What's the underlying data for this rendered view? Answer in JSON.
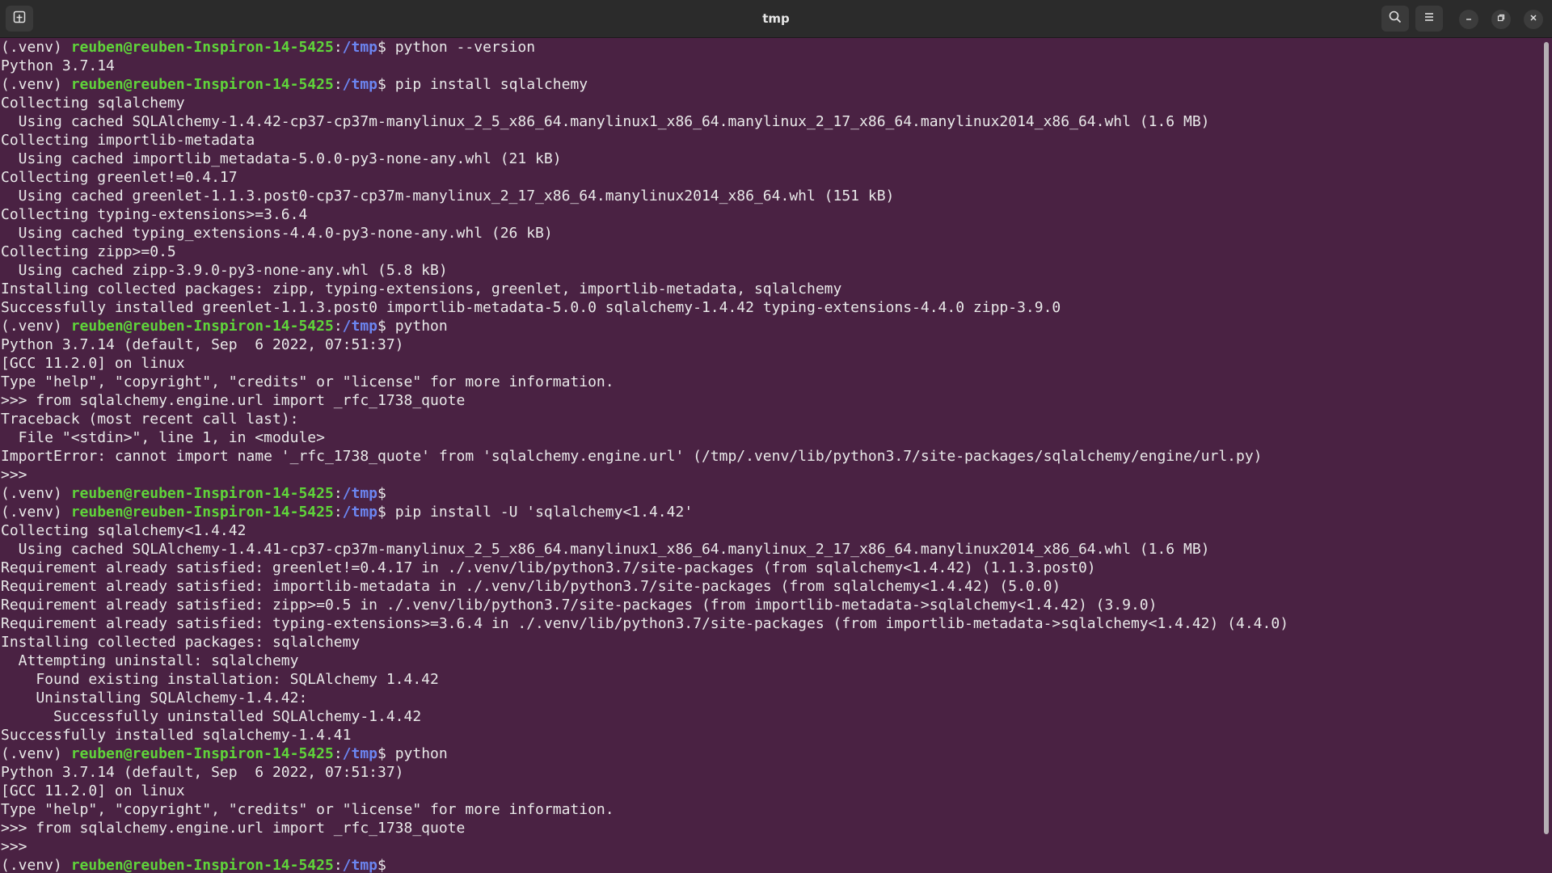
{
  "window": {
    "title": "tmp"
  },
  "prompt": {
    "venv": "(.venv) ",
    "userhost": "reuben@reuben-Inspiron-14-5425",
    "colon": ":",
    "path": "/tmp",
    "dollar": "$ "
  },
  "colors": {
    "background": "#4a2243",
    "user": "#5fd43a",
    "path": "#6c86f2",
    "text": "#e9e9e9"
  },
  "icons": {
    "new_tab": "new-tab-icon",
    "search": "search-icon",
    "menu": "hamburger-menu-icon",
    "minimize": "minimize-icon",
    "restore": "restore-icon",
    "close": "close-icon"
  },
  "terminal": {
    "lines": [
      {
        "prompt": true,
        "cmd": "python --version"
      },
      {
        "text": "Python 3.7.14"
      },
      {
        "prompt": true,
        "cmd": "pip install sqlalchemy"
      },
      {
        "text": "Collecting sqlalchemy"
      },
      {
        "text": "  Using cached SQLAlchemy-1.4.42-cp37-cp37m-manylinux_2_5_x86_64.manylinux1_x86_64.manylinux_2_17_x86_64.manylinux2014_x86_64.whl (1.6 MB)"
      },
      {
        "text": "Collecting importlib-metadata"
      },
      {
        "text": "  Using cached importlib_metadata-5.0.0-py3-none-any.whl (21 kB)"
      },
      {
        "text": "Collecting greenlet!=0.4.17"
      },
      {
        "text": "  Using cached greenlet-1.1.3.post0-cp37-cp37m-manylinux_2_17_x86_64.manylinux2014_x86_64.whl (151 kB)"
      },
      {
        "text": "Collecting typing-extensions>=3.6.4"
      },
      {
        "text": "  Using cached typing_extensions-4.4.0-py3-none-any.whl (26 kB)"
      },
      {
        "text": "Collecting zipp>=0.5"
      },
      {
        "text": "  Using cached zipp-3.9.0-py3-none-any.whl (5.8 kB)"
      },
      {
        "text": "Installing collected packages: zipp, typing-extensions, greenlet, importlib-metadata, sqlalchemy"
      },
      {
        "text": "Successfully installed greenlet-1.1.3.post0 importlib-metadata-5.0.0 sqlalchemy-1.4.42 typing-extensions-4.4.0 zipp-3.9.0"
      },
      {
        "prompt": true,
        "cmd": "python"
      },
      {
        "text": "Python 3.7.14 (default, Sep  6 2022, 07:51:37)"
      },
      {
        "text": "[GCC 11.2.0] on linux"
      },
      {
        "text": "Type \"help\", \"copyright\", \"credits\" or \"license\" for more information."
      },
      {
        "text": ">>> from sqlalchemy.engine.url import _rfc_1738_quote"
      },
      {
        "text": "Traceback (most recent call last):"
      },
      {
        "text": "  File \"<stdin>\", line 1, in <module>"
      },
      {
        "text": "ImportError: cannot import name '_rfc_1738_quote' from 'sqlalchemy.engine.url' (/tmp/.venv/lib/python3.7/site-packages/sqlalchemy/engine/url.py)"
      },
      {
        "text": ">>>"
      },
      {
        "prompt": true,
        "cmd": ""
      },
      {
        "prompt": true,
        "cmd": "pip install -U 'sqlalchemy<1.4.42'"
      },
      {
        "text": "Collecting sqlalchemy<1.4.42"
      },
      {
        "text": "  Using cached SQLAlchemy-1.4.41-cp37-cp37m-manylinux_2_5_x86_64.manylinux1_x86_64.manylinux_2_17_x86_64.manylinux2014_x86_64.whl (1.6 MB)"
      },
      {
        "text": "Requirement already satisfied: greenlet!=0.4.17 in ./.venv/lib/python3.7/site-packages (from sqlalchemy<1.4.42) (1.1.3.post0)"
      },
      {
        "text": "Requirement already satisfied: importlib-metadata in ./.venv/lib/python3.7/site-packages (from sqlalchemy<1.4.42) (5.0.0)"
      },
      {
        "text": "Requirement already satisfied: zipp>=0.5 in ./.venv/lib/python3.7/site-packages (from importlib-metadata->sqlalchemy<1.4.42) (3.9.0)"
      },
      {
        "text": "Requirement already satisfied: typing-extensions>=3.6.4 in ./.venv/lib/python3.7/site-packages (from importlib-metadata->sqlalchemy<1.4.42) (4.4.0)"
      },
      {
        "text": "Installing collected packages: sqlalchemy"
      },
      {
        "text": "  Attempting uninstall: sqlalchemy"
      },
      {
        "text": "    Found existing installation: SQLAlchemy 1.4.42"
      },
      {
        "text": "    Uninstalling SQLAlchemy-1.4.42:"
      },
      {
        "text": "      Successfully uninstalled SQLAlchemy-1.4.42"
      },
      {
        "text": "Successfully installed sqlalchemy-1.4.41"
      },
      {
        "prompt": true,
        "cmd": "python"
      },
      {
        "text": "Python 3.7.14 (default, Sep  6 2022, 07:51:37)"
      },
      {
        "text": "[GCC 11.2.0] on linux"
      },
      {
        "text": "Type \"help\", \"copyright\", \"credits\" or \"license\" for more information."
      },
      {
        "text": ">>> from sqlalchemy.engine.url import _rfc_1738_quote"
      },
      {
        "text": ">>>"
      },
      {
        "prompt": true,
        "cmd": ""
      }
    ]
  }
}
